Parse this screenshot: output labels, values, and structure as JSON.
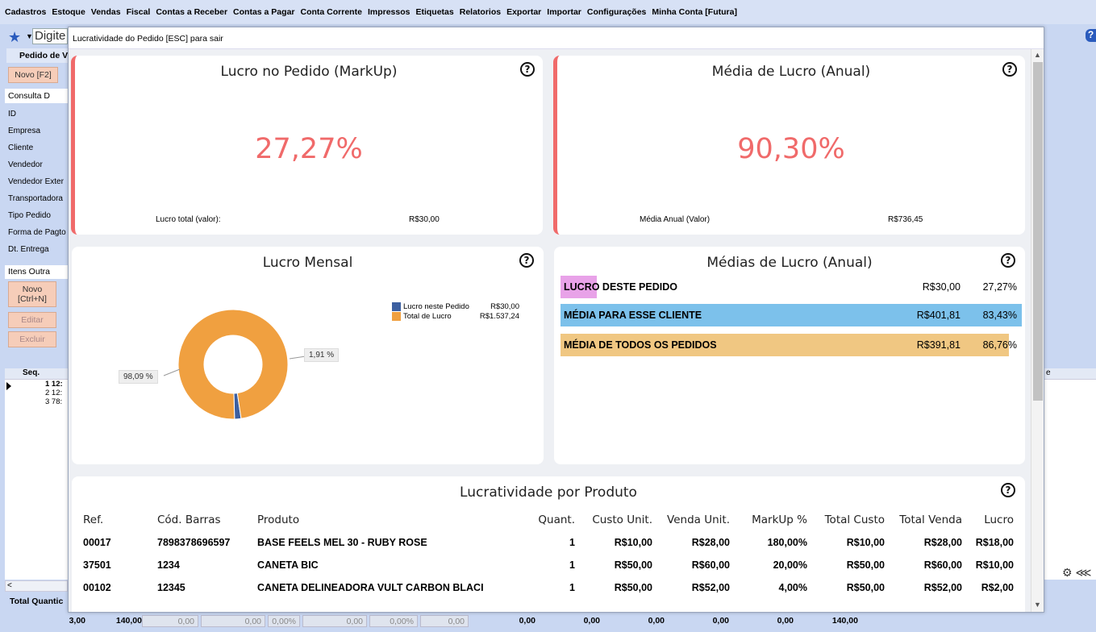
{
  "menu": [
    "Cadastros",
    "Estoque",
    "Vendas",
    "Fiscal",
    "Contas a Receber",
    "Contas a Pagar",
    "Conta Corrente",
    "Impressos",
    "Etiquetas",
    "Relatorios",
    "Exportar",
    "Importar",
    "Configurações",
    "Minha Conta [Futura]"
  ],
  "background": {
    "search_placeholder": "Digite",
    "tab_title": "Pedido de V",
    "new_button": "Novo [F2]",
    "tabs": "Consulta  D",
    "fields": [
      "ID",
      "Empresa",
      "Cliente",
      "Vendedor",
      "Vendedor Exter",
      "Transportadora",
      "Tipo Pedido",
      "Forma de Pagto",
      "Dt. Entrega"
    ],
    "item_tabs": "Itens  Outra",
    "item_buttons": {
      "new": "Novo [Ctrl+N]",
      "edit": "Editar",
      "delete": "Excluir"
    },
    "grid_header": "Seq.",
    "grid_rows": [
      "1 12:",
      "2 12:",
      "3 78:"
    ],
    "total_label": "Total Quantic",
    "right_grid_header": "e",
    "help_glyph": "?",
    "totals": [
      "3,00",
      "140,00",
      "0,00",
      "0,00",
      "0,00%",
      "0,00",
      "0,00%",
      "0,00",
      "0,00",
      "0,00",
      "0,00",
      "0,00",
      "0,00",
      "140,00"
    ]
  },
  "modal": {
    "title": "Lucratividade do Pedido [ESC] para sair",
    "markup_card": {
      "title": "Lucro no Pedido (MarkUp)",
      "value": "27,27%",
      "label": "Lucro total (valor):",
      "amount": "R$30,00"
    },
    "annual_card": {
      "title": "Média de Lucro (Anual)",
      "value": "90,30%",
      "label": "Média Anual (Valor)",
      "amount": "R$736,45"
    },
    "monthly_card": {
      "title": "Lucro Mensal",
      "legend": [
        {
          "name": "Lucro neste Pedido",
          "value": "R$30,00",
          "color": "#3c5fa0"
        },
        {
          "name": "Total de Lucro",
          "value": "R$1.537,24",
          "color": "#f0a040"
        }
      ],
      "slice_labels": {
        "small": "1,91 %",
        "large": "98,09 %"
      }
    },
    "averages_card": {
      "title": "Médias de Lucro (Anual)",
      "rows": [
        {
          "label": "LUCRO DESTE PEDIDO",
          "amount": "R$30,00",
          "percent": "27,27%",
          "color": "#e8a2e8",
          "fill": 0.2727
        },
        {
          "label": "MÉDIA PARA ESSE CLIENTE",
          "amount": "R$401,81",
          "percent": "83,43%",
          "color": "#7cc1eb",
          "fill": 0.8343
        },
        {
          "label": "MÉDIA DE TODOS OS PEDIDOS",
          "amount": "R$391,81",
          "percent": "86,76%",
          "color": "#f0c782",
          "fill": 0.8676
        }
      ]
    },
    "products_card": {
      "title": "Lucratividade por Produto",
      "headers": [
        "Ref.",
        "Cód. Barras",
        "Produto",
        "Quant.",
        "Custo Unit.",
        "Venda Unit.",
        "MarkUp %",
        "Total Custo",
        "Total Venda",
        "Lucro"
      ],
      "rows": [
        [
          "00017",
          "7898378696597",
          "BASE FEELS MEL 30 - RUBY ROSE",
          "1",
          "R$10,00",
          "R$28,00",
          "180,00%",
          "R$10,00",
          "R$28,00",
          "R$18,00"
        ],
        [
          "37501",
          "1234",
          "CANETA BIC",
          "1",
          "R$50,00",
          "R$60,00",
          "20,00%",
          "R$50,00",
          "R$60,00",
          "R$10,00"
        ],
        [
          "00102",
          "12345",
          "CANETA DELINEADORA VULT CARBON BLACI",
          "1",
          "R$50,00",
          "R$52,00",
          "4,00%",
          "R$50,00",
          "R$52,00",
          "R$2,00"
        ]
      ]
    },
    "help_glyph": "?"
  },
  "chart_data": {
    "type": "pie",
    "title": "Lucro Mensal",
    "categories": [
      "Lucro neste Pedido",
      "Total de Lucro"
    ],
    "values": [
      1.91,
      98.09
    ],
    "amounts": [
      "R$30,00",
      "R$1.537,24"
    ],
    "colors": [
      "#3c5fa0",
      "#f0a040"
    ],
    "legend": "top-right"
  }
}
